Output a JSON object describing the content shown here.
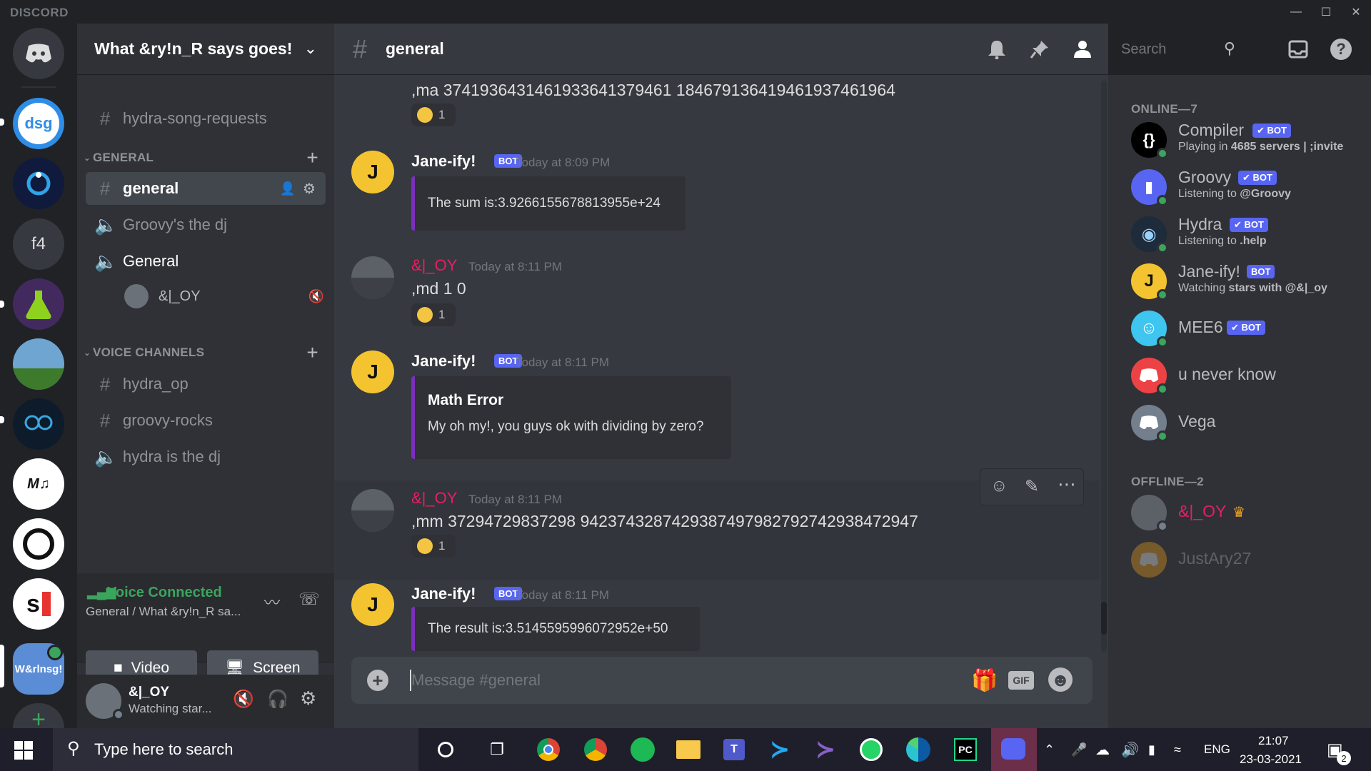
{
  "titlebar": {
    "brand": "DISCORD"
  },
  "servers": {
    "items": [
      "dsg",
      "f4",
      "W&rlnsg!"
    ]
  },
  "guild": {
    "name": "What &ry!n_R says goes!"
  },
  "sidebar": {
    "top_channel": "hydra-song-requests",
    "category_general": "GENERAL",
    "general_channels": [
      {
        "name": "general",
        "type": "text",
        "active": true
      },
      {
        "name": "Groovy's the dj",
        "type": "voice"
      },
      {
        "name": "General",
        "type": "voice"
      }
    ],
    "voice_user": "&|_OY",
    "category_voice": "VOICE CHANNELS",
    "voice_channels": [
      {
        "name": "hydra_op",
        "type": "text"
      },
      {
        "name": "groovy-rocks",
        "type": "text"
      },
      {
        "name": "hydra is the dj",
        "type": "voice"
      }
    ]
  },
  "voice_panel": {
    "status": "Voice Connected",
    "location": "General / What &ry!n_R sa...",
    "video_label": "Video",
    "screen_label": "Screen"
  },
  "user_panel": {
    "name": "&|_OY",
    "status": "Watching star..."
  },
  "chat": {
    "channel": "general",
    "search_placeholder": "Search",
    "composer_placeholder": "Message #general",
    "gif_label": "GIF",
    "messages": [
      {
        "text": ",ma 37419364314619336413794​61 18467913641946193746​1964",
        "reaction_count": "1"
      },
      {
        "author": "Jane-ify!",
        "tag": "BOT",
        "time": "Today at 8:09 PM",
        "embed": "The sum is:3.9266155678813955e+24"
      },
      {
        "author": "&|_OY",
        "time": "Today at 8:11 PM",
        "text": ",md 1 0",
        "reaction_count": "1"
      },
      {
        "author": "Jane-ify!",
        "tag": "BOT",
        "time": "Today at 8:11 PM",
        "embed_title": "Math Error",
        "embed": "My oh my!, you guys ok with dividing by zero?"
      },
      {
        "author": "&|_OY",
        "time": "Today at 8:11 PM",
        "text": ",mm 37294729837298 9423743287429387497982792742938472947",
        "reaction_count": "1"
      },
      {
        "author": "Jane-ify!",
        "tag": "BOT",
        "time": "Today at 8:11 PM",
        "embed": "The result is:3.5145595996072952e+50"
      }
    ]
  },
  "members": {
    "online_header": "ONLINE—7",
    "offline_header": "OFFLINE—2",
    "bot_tag": "✔ BOT",
    "online": [
      {
        "name": "Compiler",
        "bot": true,
        "activity_prefix": "Playing in ",
        "activity": "4685 servers | ;invite",
        "color": "#000000"
      },
      {
        "name": "Groovy",
        "bot": true,
        "activity_prefix": "Listening to ",
        "activity": "@Groovy",
        "color": "#5865f2"
      },
      {
        "name": "Hydra",
        "bot": true,
        "activity_prefix": "Listening to ",
        "activity": ".help",
        "color": "#1d2b3a"
      },
      {
        "name": "Jane-ify!",
        "bot": true,
        "activity_prefix": "Watching ",
        "activity": "stars with @&|_oy",
        "color": "#f4c430"
      },
      {
        "name": "MEE6",
        "bot": true,
        "color": "#3ec5f0"
      },
      {
        "name": "u never know",
        "bot": false,
        "color": "#ed4245"
      },
      {
        "name": "Vega",
        "bot": false,
        "color": "#747f8d"
      }
    ],
    "offline": [
      {
        "name": "&|_OY",
        "owner": true
      },
      {
        "name": "JustAry27"
      }
    ]
  },
  "taskbar": {
    "search_placeholder": "Type here to search",
    "lang": "ENG",
    "time": "21:07",
    "date": "23-03-2021",
    "notif_count": "2"
  }
}
